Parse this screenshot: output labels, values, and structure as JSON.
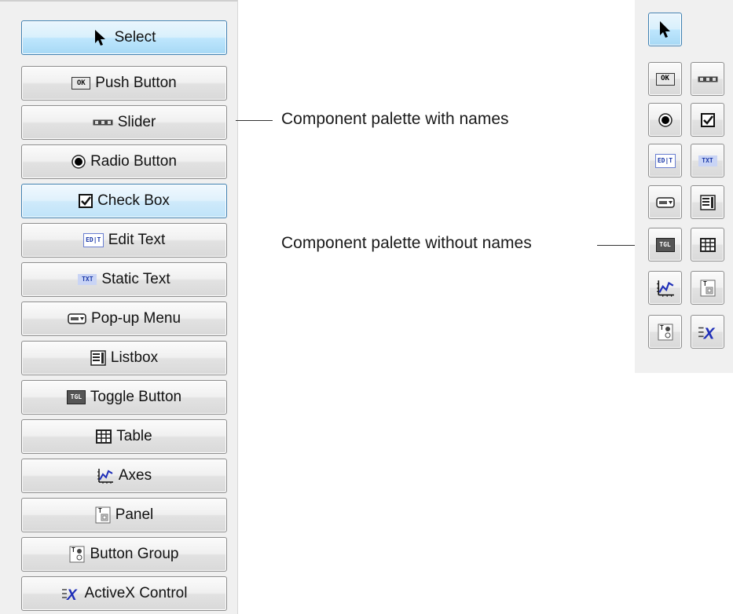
{
  "palette_named": {
    "items": [
      {
        "id": "select",
        "label": "Select",
        "icon": "arrow-pointer-icon"
      },
      {
        "id": "push-button",
        "label": "Push Button",
        "icon": "ok-icon"
      },
      {
        "id": "slider",
        "label": "Slider",
        "icon": "slider-icon"
      },
      {
        "id": "radio-button",
        "label": "Radio Button",
        "icon": "radio-icon"
      },
      {
        "id": "check-box",
        "label": "Check Box",
        "icon": "checkbox-icon"
      },
      {
        "id": "edit-text",
        "label": "Edit Text",
        "icon": "edit-text-icon"
      },
      {
        "id": "static-text",
        "label": "Static Text",
        "icon": "static-text-icon"
      },
      {
        "id": "popup-menu",
        "label": "Pop-up Menu",
        "icon": "popup-menu-icon"
      },
      {
        "id": "listbox",
        "label": "Listbox",
        "icon": "listbox-icon"
      },
      {
        "id": "toggle-button",
        "label": "Toggle Button",
        "icon": "toggle-icon"
      },
      {
        "id": "table",
        "label": "Table",
        "icon": "table-icon"
      },
      {
        "id": "axes",
        "label": "Axes",
        "icon": "axes-icon"
      },
      {
        "id": "panel",
        "label": "Panel",
        "icon": "panel-icon"
      },
      {
        "id": "button-group",
        "label": "Button Group",
        "icon": "button-group-icon"
      },
      {
        "id": "activex-control",
        "label": "ActiveX Control",
        "icon": "activex-icon"
      }
    ]
  },
  "icon_glyph_text": {
    "ok": "OK",
    "edit": "ED|T",
    "txt": "TXT",
    "tgl": "TGL",
    "panel": "T",
    "activex": "X"
  },
  "callouts": {
    "named": "Component palette with names",
    "unnamed": "Component palette without names"
  },
  "colors": {
    "palette_bg": "#f0f0f0",
    "selected_border": "#3c7fb1",
    "selected_fill": "#bee6fd",
    "activex_blue": "#1f2fb8",
    "edit_text_blue": "#1c3aa9"
  }
}
